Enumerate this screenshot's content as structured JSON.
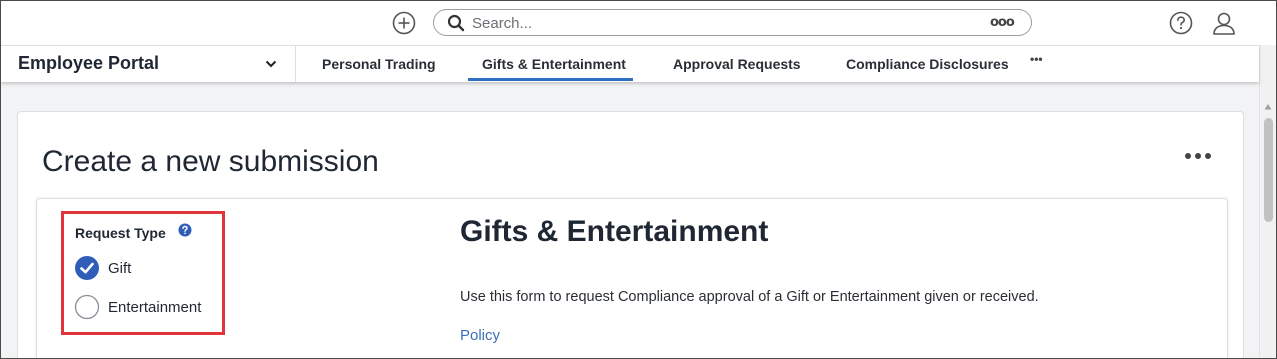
{
  "topbar": {
    "add_icon": "plus-circle-icon",
    "search": {
      "placeholder": "Search...",
      "value": "",
      "more_label": "ooo"
    },
    "help_icon": "question-circle-icon",
    "user_icon": "user-icon"
  },
  "nav": {
    "portal_name": "Employee Portal",
    "tabs": [
      {
        "label": "Personal Trading",
        "active": false
      },
      {
        "label": "Gifts & Entertainment",
        "active": true
      },
      {
        "label": "Approval Requests",
        "active": false
      },
      {
        "label": "Compliance Disclosures",
        "active": false
      }
    ],
    "more_label": "•••"
  },
  "main": {
    "title": "Create a new submission",
    "more_label": "•••",
    "request_type": {
      "label": "Request Type",
      "options": [
        {
          "label": "Gift",
          "selected": true
        },
        {
          "label": "Entertainment",
          "selected": false
        }
      ]
    },
    "form": {
      "title": "Gifts & Entertainment",
      "description": "Use this form to request Compliance approval of a Gift or Entertainment given or received.",
      "link_label": "Policy"
    }
  },
  "colors": {
    "accent": "#2f6fbf",
    "highlight_border": "#e0353b",
    "link": "#3a6fb5",
    "background": "#f2f3f5"
  }
}
